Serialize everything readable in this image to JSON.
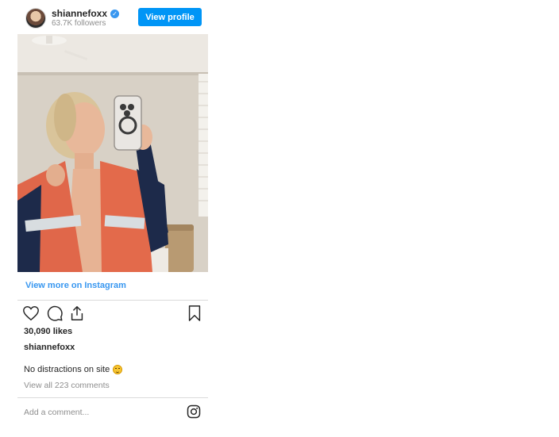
{
  "header": {
    "username": "shiannefoxx",
    "followers": "63.7K followers",
    "view_profile_label": "View profile"
  },
  "post": {
    "view_more_label": "View more on Instagram",
    "likes": "30,090 likes",
    "caption_user": "shiannefoxx",
    "caption_text": "No distractions on site",
    "view_comments": "View all 223 comments",
    "add_comment_placeholder": "Add a comment..."
  },
  "icons": {
    "verified": "verified-badge-icon",
    "like": "heart-icon",
    "comment": "comment-icon",
    "share": "share-icon",
    "save": "bookmark-icon",
    "instagram": "instagram-logo-icon",
    "emoji": "smiling-emoji-icon"
  },
  "colors": {
    "accent": "#0095f6",
    "link": "#3897f0",
    "muted": "#8e8e8e"
  }
}
